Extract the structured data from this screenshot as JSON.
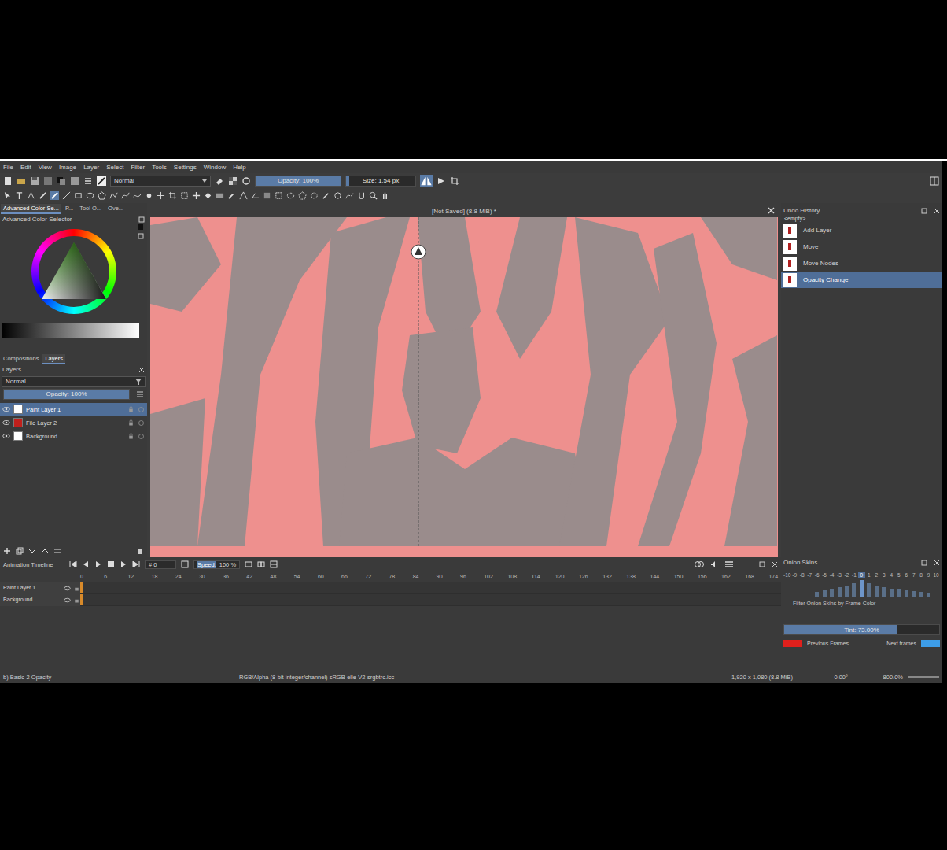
{
  "menu": [
    "File",
    "Edit",
    "View",
    "Image",
    "Layer",
    "Select",
    "Filter",
    "Tools",
    "Settings",
    "Window",
    "Help"
  ],
  "toolbar": {
    "blend_mode": "Normal",
    "opacity": {
      "label": "Opacity: 100%",
      "level": 1
    },
    "size": {
      "label": "Size: 1.54 px",
      "level": 0.05
    }
  },
  "color_docker": {
    "tabs": [
      {
        "label": "Advanced Color Se...",
        "selected": true
      },
      {
        "label": "P...",
        "selected": false
      },
      {
        "label": "Tool O...",
        "selected": false
      },
      {
        "label": "Ove...",
        "selected": false
      }
    ],
    "title": "Advanced Color Selector"
  },
  "layers_docker": {
    "tabs": [
      {
        "label": "Compositions",
        "selected": false
      },
      {
        "label": "Layers",
        "selected": true
      }
    ],
    "title": "Layers",
    "blend_mode": "Normal",
    "opacity": {
      "label": "Opacity:  100%",
      "level": 1
    },
    "layers": [
      {
        "name": "Paint Layer 1",
        "selected": true,
        "color": "#ffffff"
      },
      {
        "name": "File Layer 2",
        "selected": false,
        "color": "#c0201c"
      },
      {
        "name": "Background",
        "selected": false,
        "color": "#ffffff"
      }
    ]
  },
  "canvas": {
    "title": "[Not Saved] (8.8 MiB) *"
  },
  "undo": {
    "title": "Undo History",
    "empty_label": "<empty>",
    "items": [
      {
        "label": "Add Layer",
        "selected": false
      },
      {
        "label": "Move",
        "selected": false
      },
      {
        "label": "Move Nodes",
        "selected": false
      },
      {
        "label": "Opacity Change",
        "selected": true
      }
    ]
  },
  "timeline": {
    "title": "Animation Timeline",
    "frame": "# 0",
    "speed_label": "Speed:",
    "speed": "100 %",
    "ruler": [
      "0",
      "6",
      "12",
      "18",
      "24",
      "30",
      "36",
      "42",
      "48",
      "54",
      "60",
      "66",
      "72",
      "78",
      "84",
      "90",
      "96",
      "102",
      "108",
      "114",
      "120",
      "126",
      "132",
      "138",
      "144",
      "150",
      "156",
      "162",
      "168",
      "174"
    ],
    "layers": [
      {
        "name": "Paint Layer 1"
      },
      {
        "name": "Background"
      }
    ]
  },
  "onion": {
    "title": "Onion Skins",
    "frames": [
      {
        "label": "-10",
        "level": 0,
        "selected": false
      },
      {
        "label": "-9",
        "level": 0,
        "selected": false
      },
      {
        "label": "-8",
        "level": 0,
        "selected": false
      },
      {
        "label": "-7",
        "level": 0,
        "selected": false
      },
      {
        "label": "-6",
        "level": 0.3,
        "selected": false
      },
      {
        "label": "-5",
        "level": 0.4,
        "selected": false
      },
      {
        "label": "-4",
        "level": 0.5,
        "selected": false
      },
      {
        "label": "-3",
        "level": 0.6,
        "selected": false
      },
      {
        "label": "-2",
        "level": 0.7,
        "selected": false
      },
      {
        "label": "-1",
        "level": 0.8,
        "selected": false
      },
      {
        "label": "0",
        "level": 1,
        "selected": true
      },
      {
        "label": "1",
        "level": 0.8,
        "selected": false
      },
      {
        "label": "2",
        "level": 0.7,
        "selected": false
      },
      {
        "label": "3",
        "level": 0.6,
        "selected": false
      },
      {
        "label": "4",
        "level": 0.5,
        "selected": false
      },
      {
        "label": "5",
        "level": 0.45,
        "selected": false
      },
      {
        "label": "6",
        "level": 0.4,
        "selected": false
      },
      {
        "label": "7",
        "level": 0.35,
        "selected": false
      },
      {
        "label": "8",
        "level": 0.3,
        "selected": false
      },
      {
        "label": "9",
        "level": 0.25,
        "selected": false
      },
      {
        "label": "10",
        "level": 0,
        "selected": false
      }
    ],
    "filter_label": "Filter Onion Skins by Frame Color",
    "tint": {
      "label": "Tint: 73.00%",
      "level": 0.73
    },
    "previous": {
      "label": "Previous Frames",
      "color": "#e0201c"
    },
    "next": {
      "label": "Next frames",
      "color": "#3d9de8"
    }
  },
  "status": {
    "tool": "b) Basic-2 Opacity",
    "color_space": "RGB/Alpha (8-bit integer/channel) sRGB-elle-V2-srgbtrc.icc",
    "image_size": "1,920 x 1,080 (8.8 MiB)",
    "rotation": "0.00°",
    "zoom": "800.0%"
  }
}
